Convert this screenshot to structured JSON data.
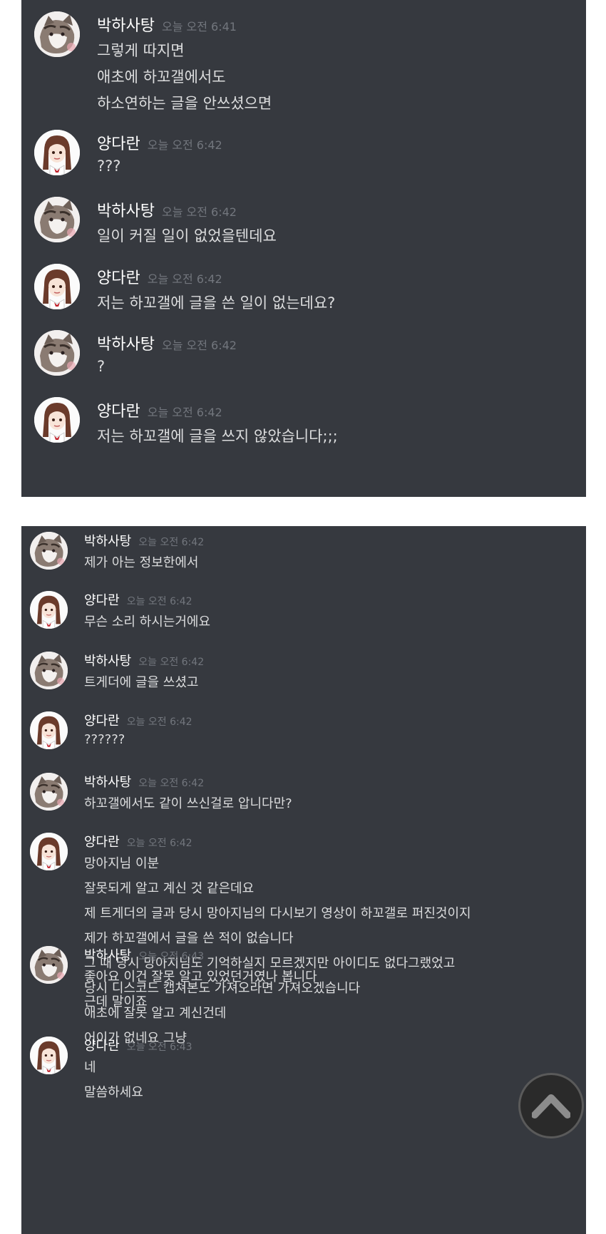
{
  "panel1": {
    "messages": [
      {
        "author": "박하사탕",
        "time": "오늘 오전 6:41",
        "avatar": "cat-avatar",
        "lines": [
          "그렇게 따지면",
          "애초에 하꼬갤에서도",
          "하소연하는 글을 안쓰셨으면"
        ]
      },
      {
        "author": "양다란",
        "time": "오늘 오전 6:42",
        "avatar": "girl-avatar",
        "lines": [
          "???"
        ]
      },
      {
        "author": "박하사탕",
        "time": "오늘 오전 6:42",
        "avatar": "cat-avatar",
        "lines": [
          "일이 커질 일이 없었을텐데요"
        ]
      },
      {
        "author": "양다란",
        "time": "오늘 오전 6:42",
        "avatar": "girl-avatar",
        "lines": [
          "저는 하꼬갤에 글을 쓴 일이 없는데요?"
        ]
      },
      {
        "author": "박하사탕",
        "time": "오늘 오전 6:42",
        "avatar": "cat-avatar",
        "lines": [
          "?"
        ]
      },
      {
        "author": "양다란",
        "time": "오늘 오전 6:42",
        "avatar": "girl-avatar",
        "lines": [
          "저는 하꼬갤에 글을 쓰지 않았습니다;;;"
        ]
      }
    ]
  },
  "panel2": {
    "messages": [
      {
        "author": "박하사탕",
        "time": "오늘 오전 6:42",
        "avatar": "cat-avatar",
        "lines": [
          "제가 아는 정보한에서"
        ]
      },
      {
        "author": "양다란",
        "time": "오늘 오전 6:42",
        "avatar": "girl-avatar",
        "lines": [
          "무슨 소리 하시는거에요"
        ]
      },
      {
        "author": "박하사탕",
        "time": "오늘 오전 6:42",
        "avatar": "cat-avatar",
        "lines": [
          "트게더에 글을 쓰셨고"
        ]
      },
      {
        "author": "양다란",
        "time": "오늘 오전 6:42",
        "avatar": "girl-avatar",
        "lines": [
          "??????"
        ]
      },
      {
        "author": "박하사탕",
        "time": "오늘 오전 6:42",
        "avatar": "cat-avatar",
        "lines": [
          "하꼬갤에서도 같이 쓰신걸로 압니다만?"
        ]
      },
      {
        "author": "양다란",
        "time": "오늘 오전 6:42",
        "avatar": "girl-avatar",
        "lines": [
          "망아지님 이분",
          "잘못되게 알고 계신 것 같은데요",
          "제 트게더의 글과 당시 망아지님의 다시보기 영상이 하꼬갤로 퍼진것이지",
          "제가 하꼬갤에서 글을 쓴 적이 없습니다",
          "그 때 당시 망아지님도 기억하실지 모르겠지만 아이디도 없다그랬었고",
          "당시 디스코드 캡쳐본도 가져오라면 가져오겠습니다",
          "애초에 잘못 알고 계신건데",
          "어이가 없네요 그냥"
        ]
      },
      {
        "author": "박하사탕",
        "time": "오늘 오전 6:43",
        "avatar": "cat-avatar",
        "lines": [
          "좋아요 이건 잘못 알고 있었던거였나 봅니다",
          "근데 말이죠"
        ]
      },
      {
        "author": "양다란",
        "time": "오늘 오전 6:43",
        "avatar": "girl-avatar",
        "lines": [
          "네",
          "말씀하세요"
        ]
      }
    ]
  },
  "scroll_top": {
    "icon": "chevron-up-icon"
  }
}
